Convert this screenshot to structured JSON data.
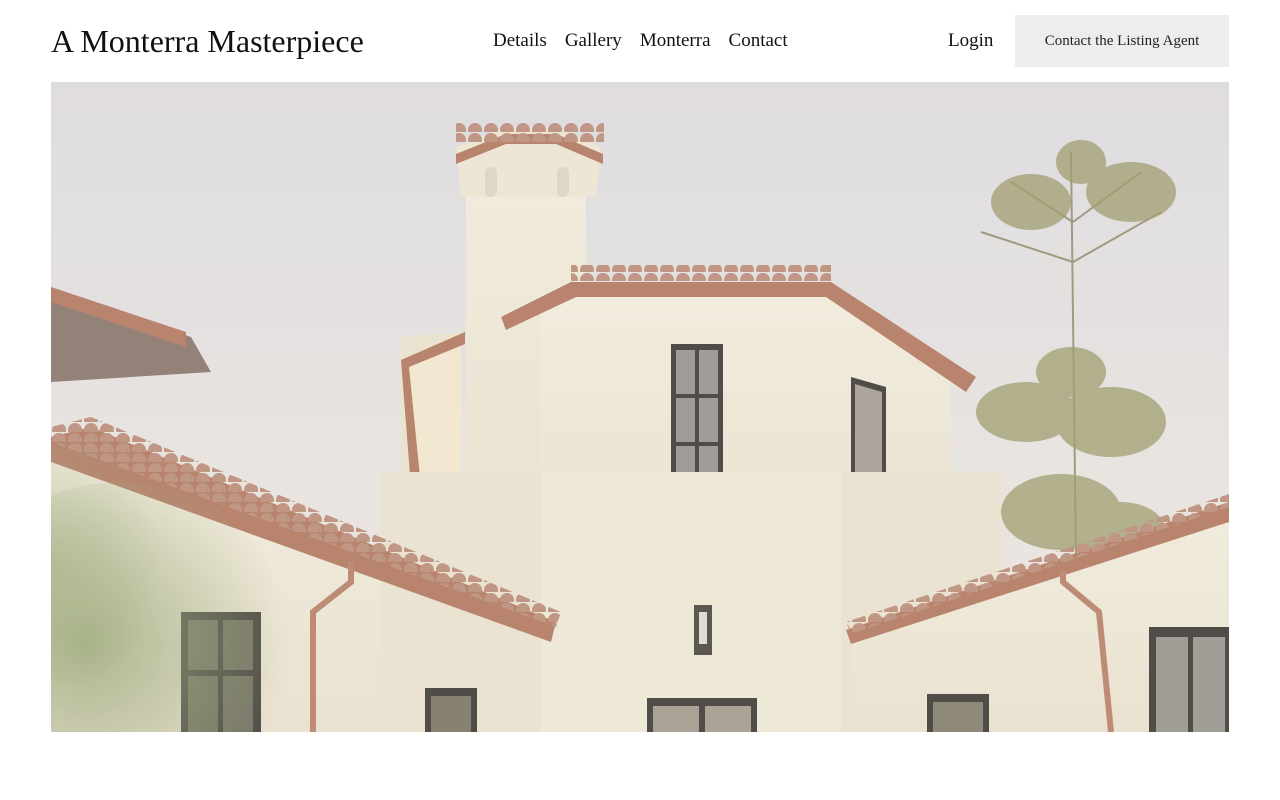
{
  "header": {
    "site_title": "A Monterra Masterpiece",
    "nav": [
      {
        "label": "Details"
      },
      {
        "label": "Gallery"
      },
      {
        "label": "Monterra"
      },
      {
        "label": "Contact"
      }
    ],
    "login_label": "Login",
    "cta_label": "Contact the Listing Agent"
  },
  "hero": {
    "subject": "villa-exterior-photo",
    "colors": {
      "sky": "#dcd8da",
      "stucco": "#ece5d3",
      "roof_tile": "#b07a60",
      "trim": "#a5624a",
      "window_frame": "#2a2622"
    }
  }
}
